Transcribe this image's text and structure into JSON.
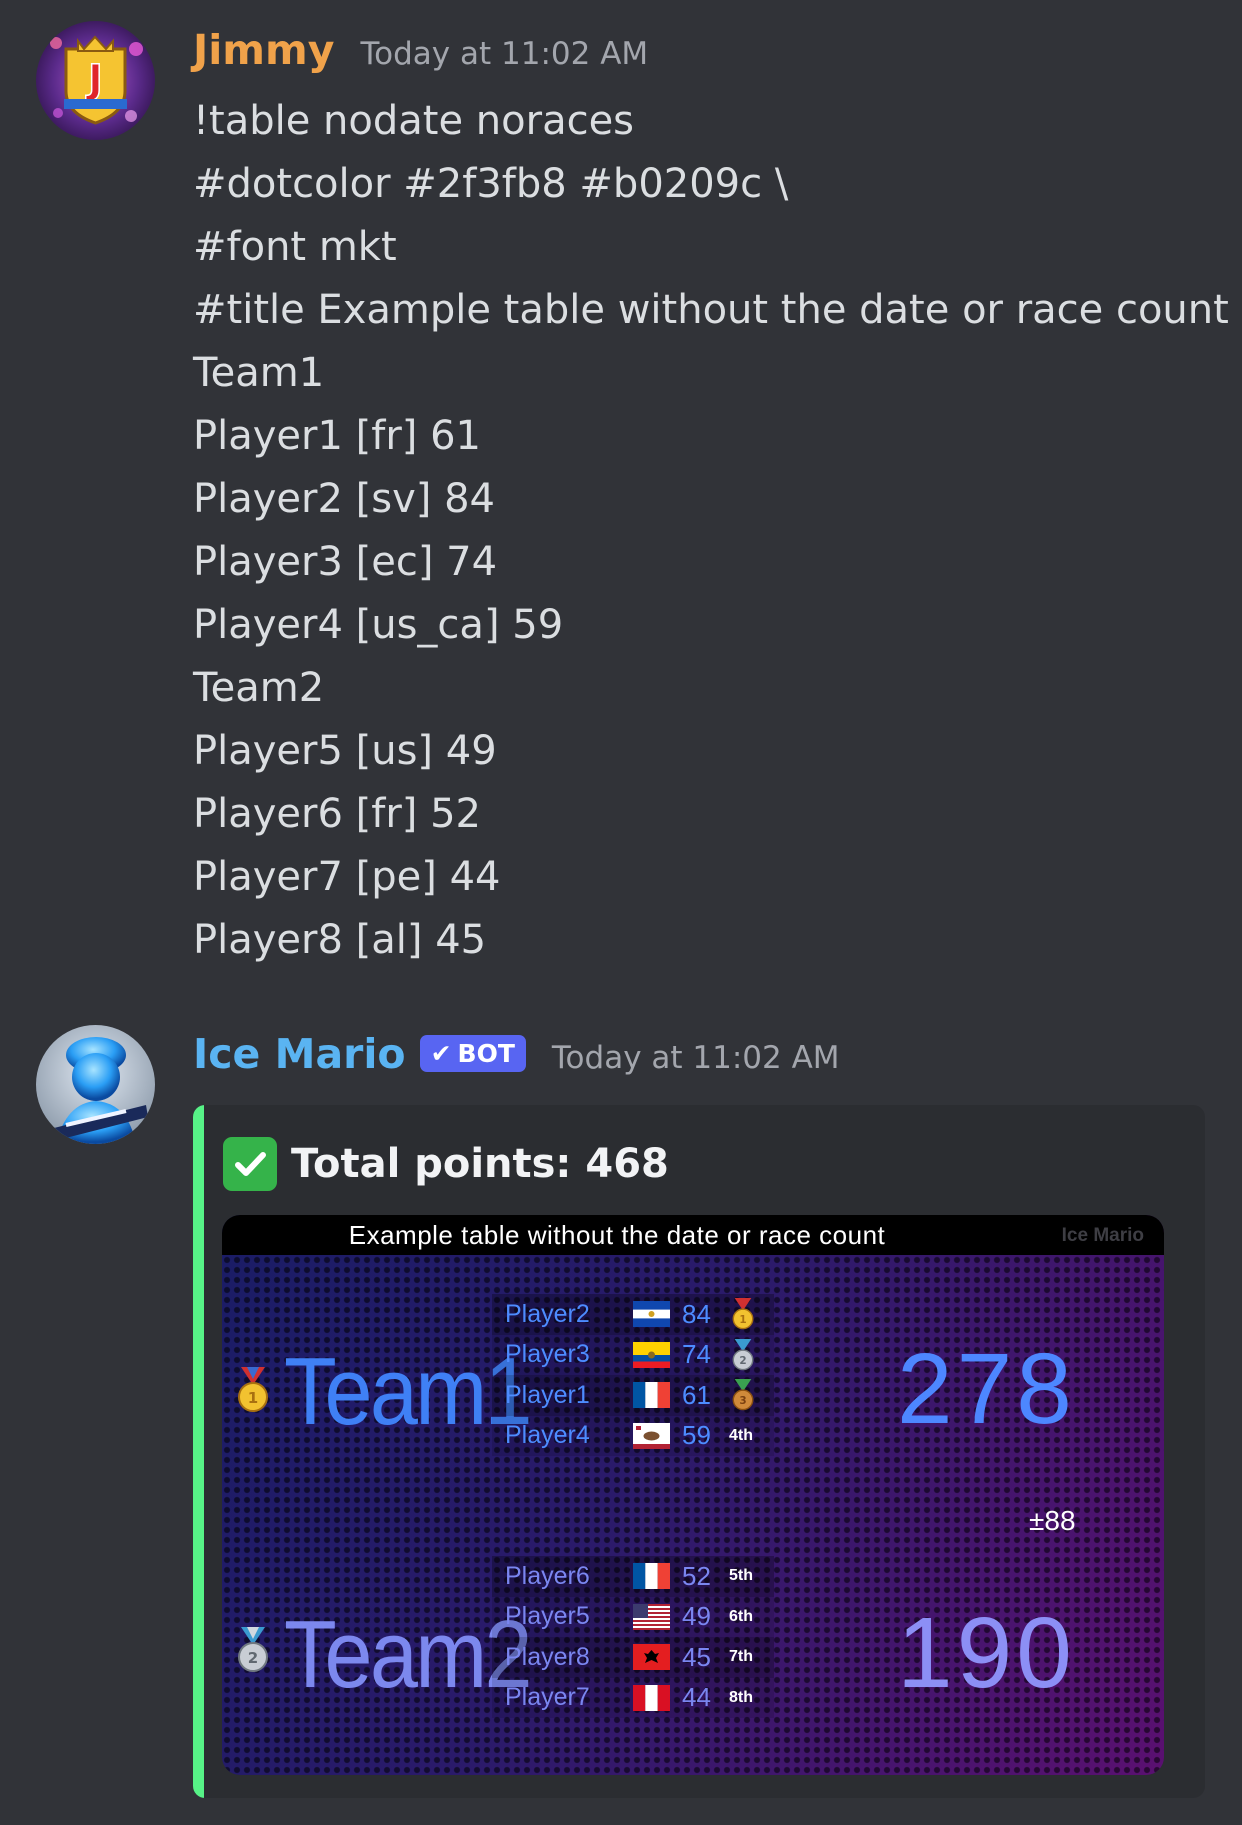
{
  "messages": [
    {
      "username": "Jimmy",
      "timestamp": "Today at 11:02 AM",
      "lines": [
        "!table nodate noraces",
        "#dotcolor #2f3fb8 #b0209c \\",
        "#font mkt",
        "#title Example table without the date or race count",
        "Team1",
        "Player1 [fr] 61",
        "Player2 [sv] 84",
        "Player3 [ec] 74",
        "Player4 [us_ca] 59",
        "Team2",
        "Player5 [us] 49",
        "Player6 [fr] 52",
        "Player7 [pe] 44",
        "Player8 [al] 45"
      ]
    },
    {
      "username": "Ice Mario",
      "badge": "BOT",
      "timestamp": "Today at 11:02 AM"
    }
  ],
  "embed": {
    "title": "Total points: 468",
    "accent_color": "#57f287",
    "table": {
      "title": "Example table without the date or race count",
      "watermark": "Ice Mario",
      "difference": "±88",
      "teams": [
        {
          "name": "Team1",
          "score": "278",
          "medal": "gold",
          "players": [
            {
              "name": "Player2",
              "flag": "sv",
              "score": "84",
              "place": "gold-medal-icon"
            },
            {
              "name": "Player3",
              "flag": "ec",
              "score": "74",
              "place": "silver-medal-icon"
            },
            {
              "name": "Player1",
              "flag": "fr",
              "score": "61",
              "place": "bronze-medal-icon"
            },
            {
              "name": "Player4",
              "flag": "us_ca",
              "score": "59",
              "place": "4th"
            }
          ]
        },
        {
          "name": "Team2",
          "score": "190",
          "medal": "silver",
          "players": [
            {
              "name": "Player6",
              "flag": "fr",
              "score": "52",
              "place": "5th"
            },
            {
              "name": "Player5",
              "flag": "us",
              "score": "49",
              "place": "6th"
            },
            {
              "name": "Player8",
              "flag": "al",
              "score": "45",
              "place": "7th"
            },
            {
              "name": "Player7",
              "flag": "pe",
              "score": "44",
              "place": "8th"
            }
          ]
        }
      ]
    }
  }
}
